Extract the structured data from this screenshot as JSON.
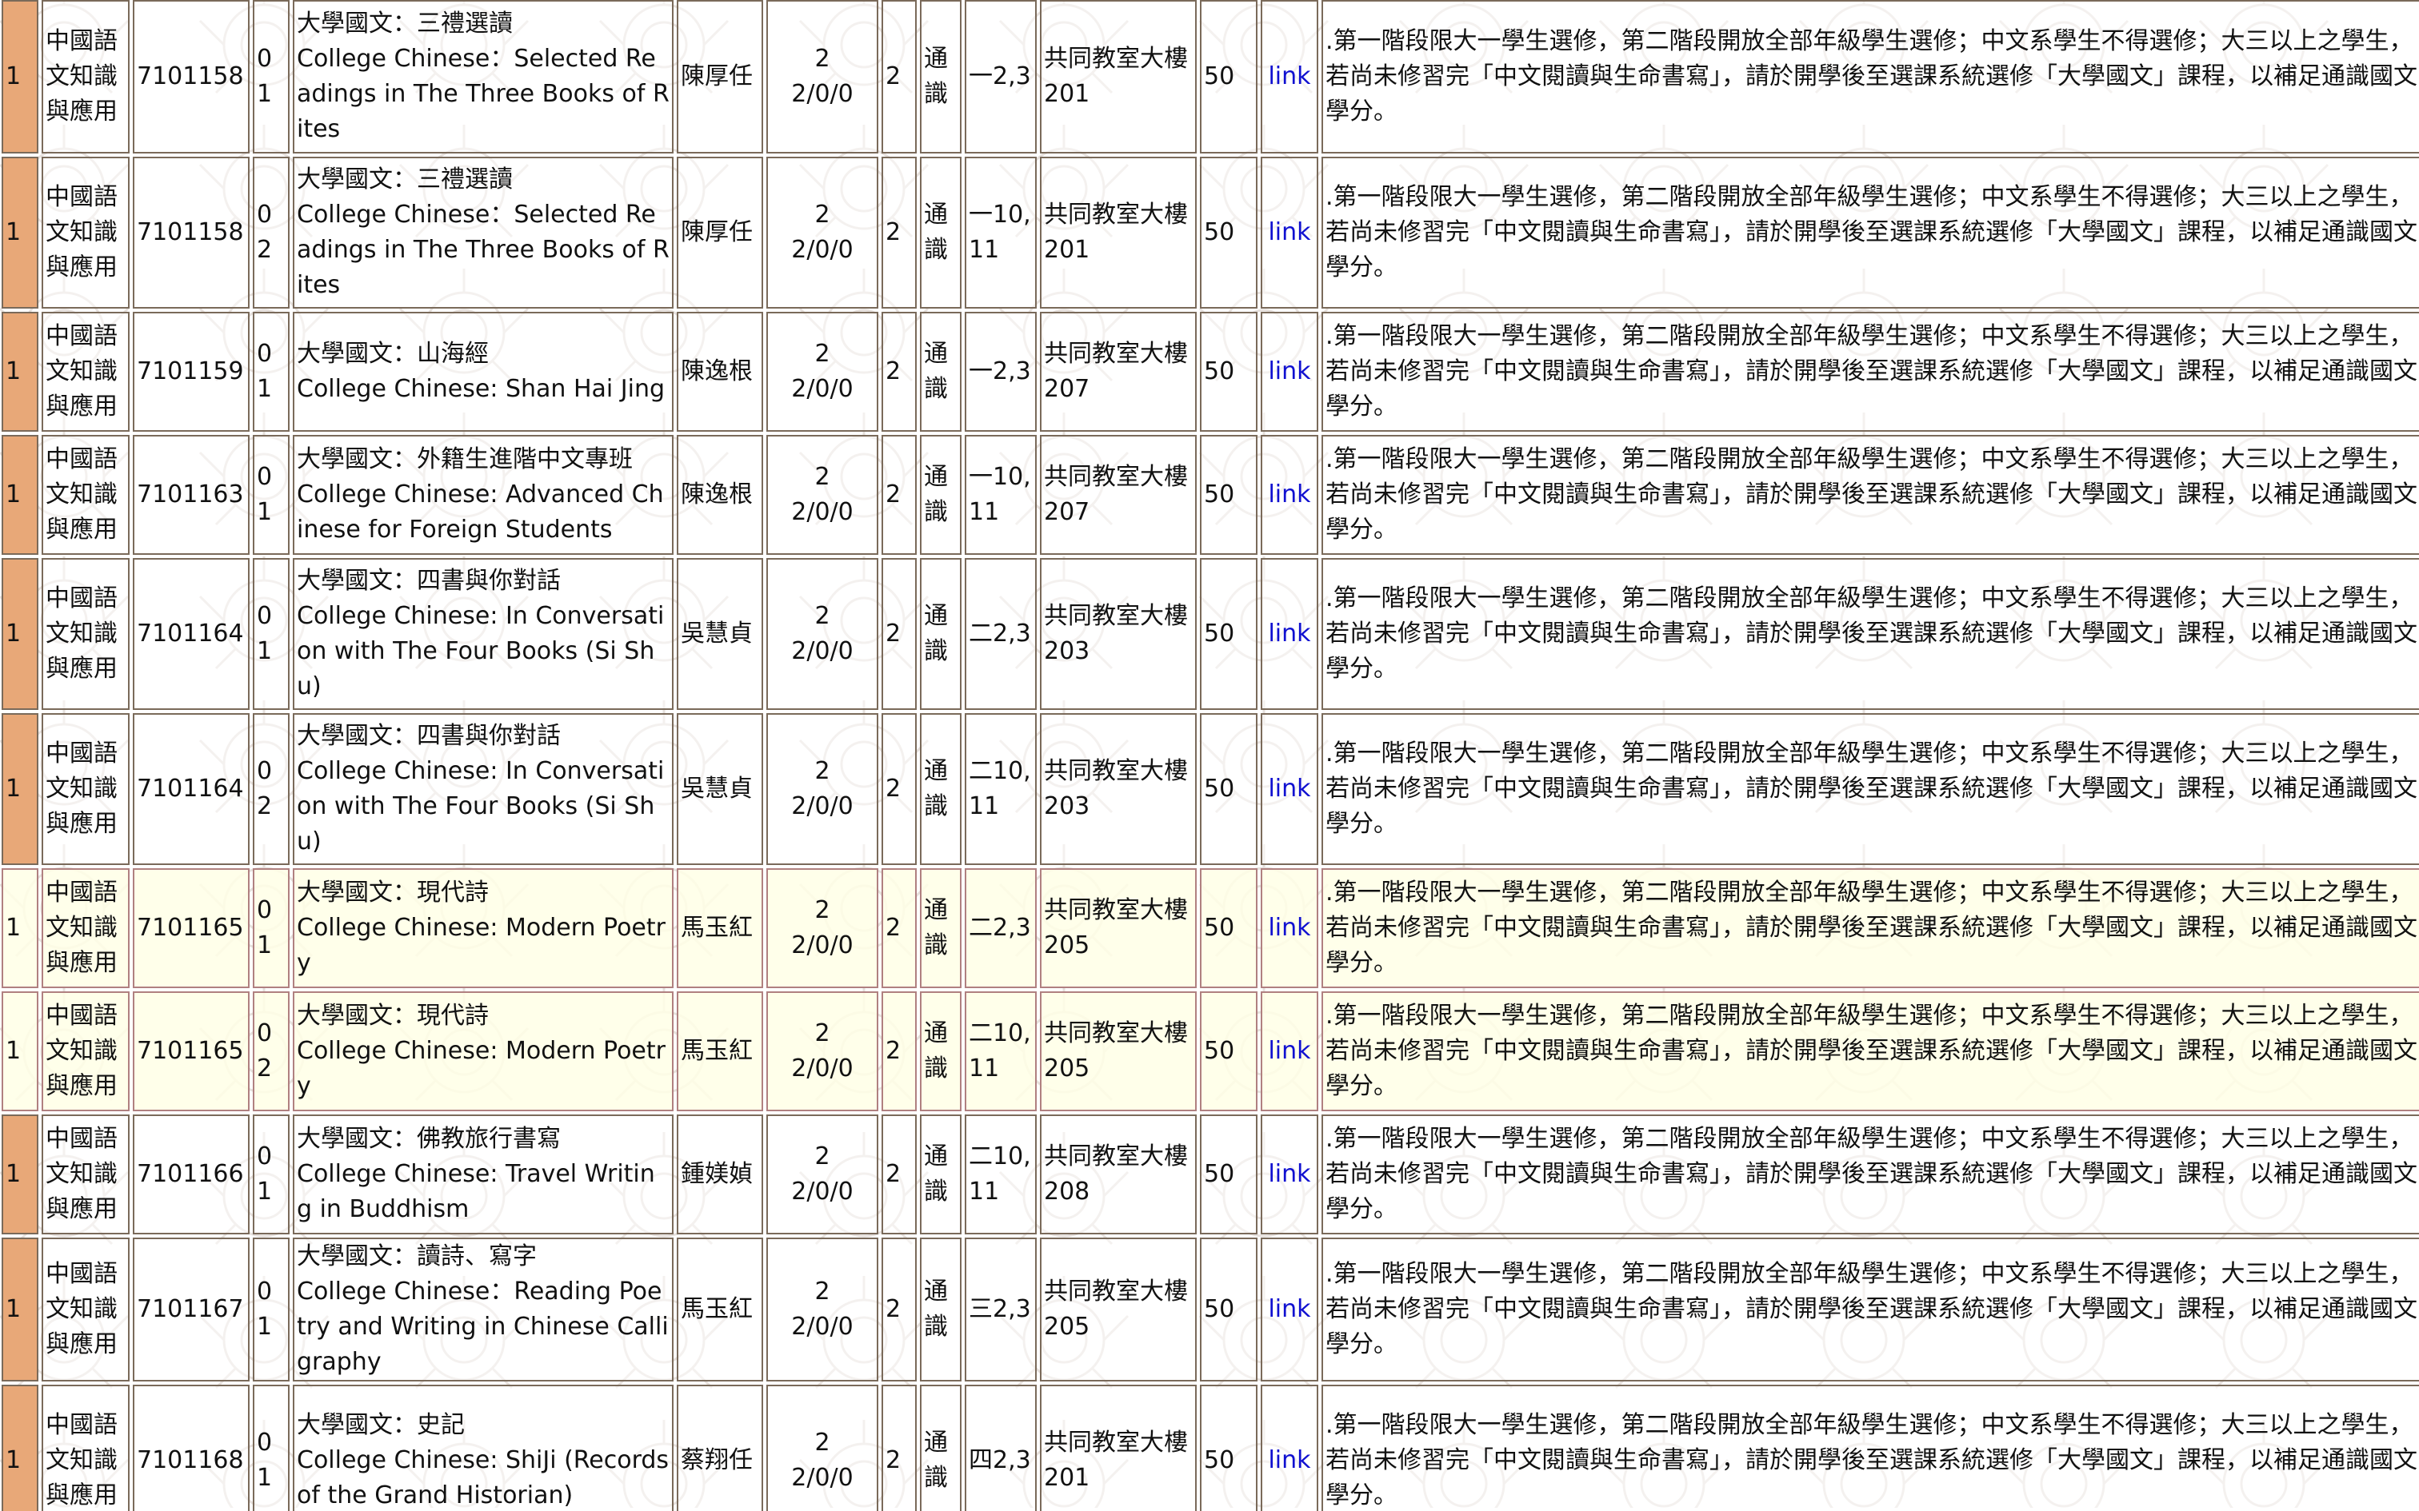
{
  "rows": [
    {
      "mark": "1",
      "category": "中國語文知識與應用",
      "code": "7101158",
      "section": "01",
      "title_zh": "大學國文：三禮選讀",
      "title_en": "College Chinese：Selected Readings in The Three Books of Rites",
      "teacher": "陳厚任",
      "credits_top": "2",
      "credits_hours": "2/0/0",
      "credit": "2",
      "type": "通識",
      "time": "一2,3",
      "room": "共同教室大樓201",
      "capacity": "50",
      "link": "link",
      "note": ".第一階段限大一學生選修，第二階段開放全部年級學生選修；中文系學生不得選修；大三以上之學生，若尚未修習完「中文閱讀與生命書寫」，請於開學後至選課系統選修「大學國文」課程，以補足通識國文學分。",
      "style": "normal"
    },
    {
      "mark": "1",
      "category": "中國語文知識與應用",
      "code": "7101158",
      "section": "02",
      "title_zh": "大學國文：三禮選讀",
      "title_en": "College Chinese：Selected Readings in The Three Books of Rites",
      "teacher": "陳厚任",
      "credits_top": "2",
      "credits_hours": "2/0/0",
      "credit": "2",
      "type": "通識",
      "time": "一10,11",
      "room": "共同教室大樓201",
      "capacity": "50",
      "link": "link",
      "note": ".第一階段限大一學生選修，第二階段開放全部年級學生選修；中文系學生不得選修；大三以上之學生，若尚未修習完「中文閱讀與生命書寫」，請於開學後至選課系統選修「大學國文」課程，以補足通識國文學分。",
      "style": "normal"
    },
    {
      "mark": "1",
      "category": "中國語文知識與應用",
      "code": "7101159",
      "section": "01",
      "title_zh": "大學國文：山海經",
      "title_en": "College Chinese: Shan Hai Jing",
      "teacher": "陳逸根",
      "credits_top": "2",
      "credits_hours": "2/0/0",
      "credit": "2",
      "type": "通識",
      "time": "一2,3",
      "room": "共同教室大樓207",
      "capacity": "50",
      "link": "link",
      "note": ".第一階段限大一學生選修，第二階段開放全部年級學生選修；中文系學生不得選修；大三以上之學生，若尚未修習完「中文閱讀與生命書寫」，請於開學後至選課系統選修「大學國文」課程，以補足通識國文學分。",
      "style": "normal"
    },
    {
      "mark": "1",
      "category": "中國語文知識與應用",
      "code": "7101163",
      "section": "01",
      "title_zh": "大學國文：外籍生進階中文專班",
      "title_en": "College Chinese: Advanced Chinese for Foreign Students",
      "teacher": "陳逸根",
      "credits_top": "2",
      "credits_hours": "2/0/0",
      "credit": "2",
      "type": "通識",
      "time": "一10,11",
      "room": "共同教室大樓207",
      "capacity": "50",
      "link": "link",
      "note": ".第一階段限大一學生選修，第二階段開放全部年級學生選修；中文系學生不得選修；大三以上之學生，若尚未修習完「中文閱讀與生命書寫」，請於開學後至選課系統選修「大學國文」課程，以補足通識國文學分。",
      "style": "normal"
    },
    {
      "mark": "1",
      "category": "中國語文知識與應用",
      "code": "7101164",
      "section": "01",
      "title_zh": "大學國文：四書與你對話",
      "title_en": "College Chinese: In Conversation with The Four Books (Si Shu)",
      "teacher": "吳慧貞",
      "credits_top": "2",
      "credits_hours": "2/0/0",
      "credit": "2",
      "type": "通識",
      "time": "二2,3",
      "room": "共同教室大樓203",
      "capacity": "50",
      "link": "link",
      "note": ".第一階段限大一學生選修，第二階段開放全部年級學生選修；中文系學生不得選修；大三以上之學生，若尚未修習完「中文閱讀與生命書寫」，請於開學後至選課系統選修「大學國文」課程，以補足通識國文學分。",
      "style": "normal"
    },
    {
      "mark": "1",
      "category": "中國語文知識與應用",
      "code": "7101164",
      "section": "02",
      "title_zh": "大學國文：四書與你對話",
      "title_en": "College Chinese: In Conversation with The Four Books (Si Shu)",
      "teacher": "吳慧貞",
      "credits_top": "2",
      "credits_hours": "2/0/0",
      "credit": "2",
      "type": "通識",
      "time": "二10,11",
      "room": "共同教室大樓203",
      "capacity": "50",
      "link": "link",
      "note": ".第一階段限大一學生選修，第二階段開放全部年級學生選修；中文系學生不得選修；大三以上之學生，若尚未修習完「中文閱讀與生命書寫」，請於開學後至選課系統選修「大學國文」課程，以補足通識國文學分。",
      "style": "normal"
    },
    {
      "mark": "1",
      "category": "中國語文知識與應用",
      "code": "7101165",
      "section": "01",
      "title_zh": "大學國文：現代詩",
      "title_en": "College Chinese: Modern Poetry",
      "teacher": "馬玉紅",
      "credits_top": "2",
      "credits_hours": "2/0/0",
      "credit": "2",
      "type": "通識",
      "time": "二2,3",
      "room": "共同教室大樓205",
      "capacity": "50",
      "link": "link",
      "note": ".第一階段限大一學生選修，第二階段開放全部年級學生選修；中文系學生不得選修；大三以上之學生，若尚未修習完「中文閱讀與生命書寫」，請於開學後至選課系統選修「大學國文」課程，以補足通識國文學分。",
      "style": "highlight"
    },
    {
      "mark": "1",
      "category": "中國語文知識與應用",
      "code": "7101165",
      "section": "02",
      "title_zh": "大學國文：現代詩",
      "title_en": "College Chinese: Modern Poetry",
      "teacher": "馬玉紅",
      "credits_top": "2",
      "credits_hours": "2/0/0",
      "credit": "2",
      "type": "通識",
      "time": "二10,11",
      "room": "共同教室大樓205",
      "capacity": "50",
      "link": "link",
      "note": ".第一階段限大一學生選修，第二階段開放全部年級學生選修；中文系學生不得選修；大三以上之學生，若尚未修習完「中文閱讀與生命書寫」，請於開學後至選課系統選修「大學國文」課程，以補足通識國文學分。",
      "style": "highlight"
    },
    {
      "mark": "1",
      "category": "中國語文知識與應用",
      "code": "7101166",
      "section": "01",
      "title_zh": "大學國文：佛教旅行書寫",
      "title_en": "College Chinese: Travel Writing in Buddhism",
      "teacher": "鍾媄媜",
      "credits_top": "2",
      "credits_hours": "2/0/0",
      "credit": "2",
      "type": "通識",
      "time": "二10,11",
      "room": "共同教室大樓208",
      "capacity": "50",
      "link": "link",
      "note": ".第一階段限大一學生選修，第二階段開放全部年級學生選修；中文系學生不得選修；大三以上之學生，若尚未修習完「中文閱讀與生命書寫」，請於開學後至選課系統選修「大學國文」課程，以補足通識國文學分。",
      "style": "normal"
    },
    {
      "mark": "1",
      "category": "中國語文知識與應用",
      "code": "7101167",
      "section": "01",
      "title_zh": "大學國文：讀詩、寫字",
      "title_en": "College Chinese：Reading Poetry and Writing in Chinese Calligraphy",
      "teacher": "馬玉紅",
      "credits_top": "2",
      "credits_hours": "2/0/0",
      "credit": "2",
      "type": "通識",
      "time": "三2,3",
      "room": "共同教室大樓205",
      "capacity": "50",
      "link": "link",
      "note": ".第一階段限大一學生選修，第二階段開放全部年級學生選修；中文系學生不得選修；大三以上之學生，若尚未修習完「中文閱讀與生命書寫」，請於開學後至選課系統選修「大學國文」課程，以補足通識國文學分。",
      "style": "normal"
    },
    {
      "mark": "1",
      "category": "中國語文知識與應用",
      "code": "7101168",
      "section": "01",
      "title_zh": "大學國文：史記",
      "title_en": "College Chinese: ShiJi (Records of the Grand Historian)",
      "teacher": "蔡翔任",
      "credits_top": "2",
      "credits_hours": "2/0/0",
      "credit": "2",
      "type": "通識",
      "time": "四2,3",
      "room": "共同教室大樓201",
      "capacity": "50",
      "link": "link",
      "note": ".第一階段限大一學生選修，第二階段開放全部年級學生選修；中文系學生不得選修；大三以上之學生，若尚未修習完「中文閱讀與生命書寫」，請於開學後至選課系統選修「大學國文」課程，以補足通識國文學分。",
      "style": "normal"
    }
  ]
}
